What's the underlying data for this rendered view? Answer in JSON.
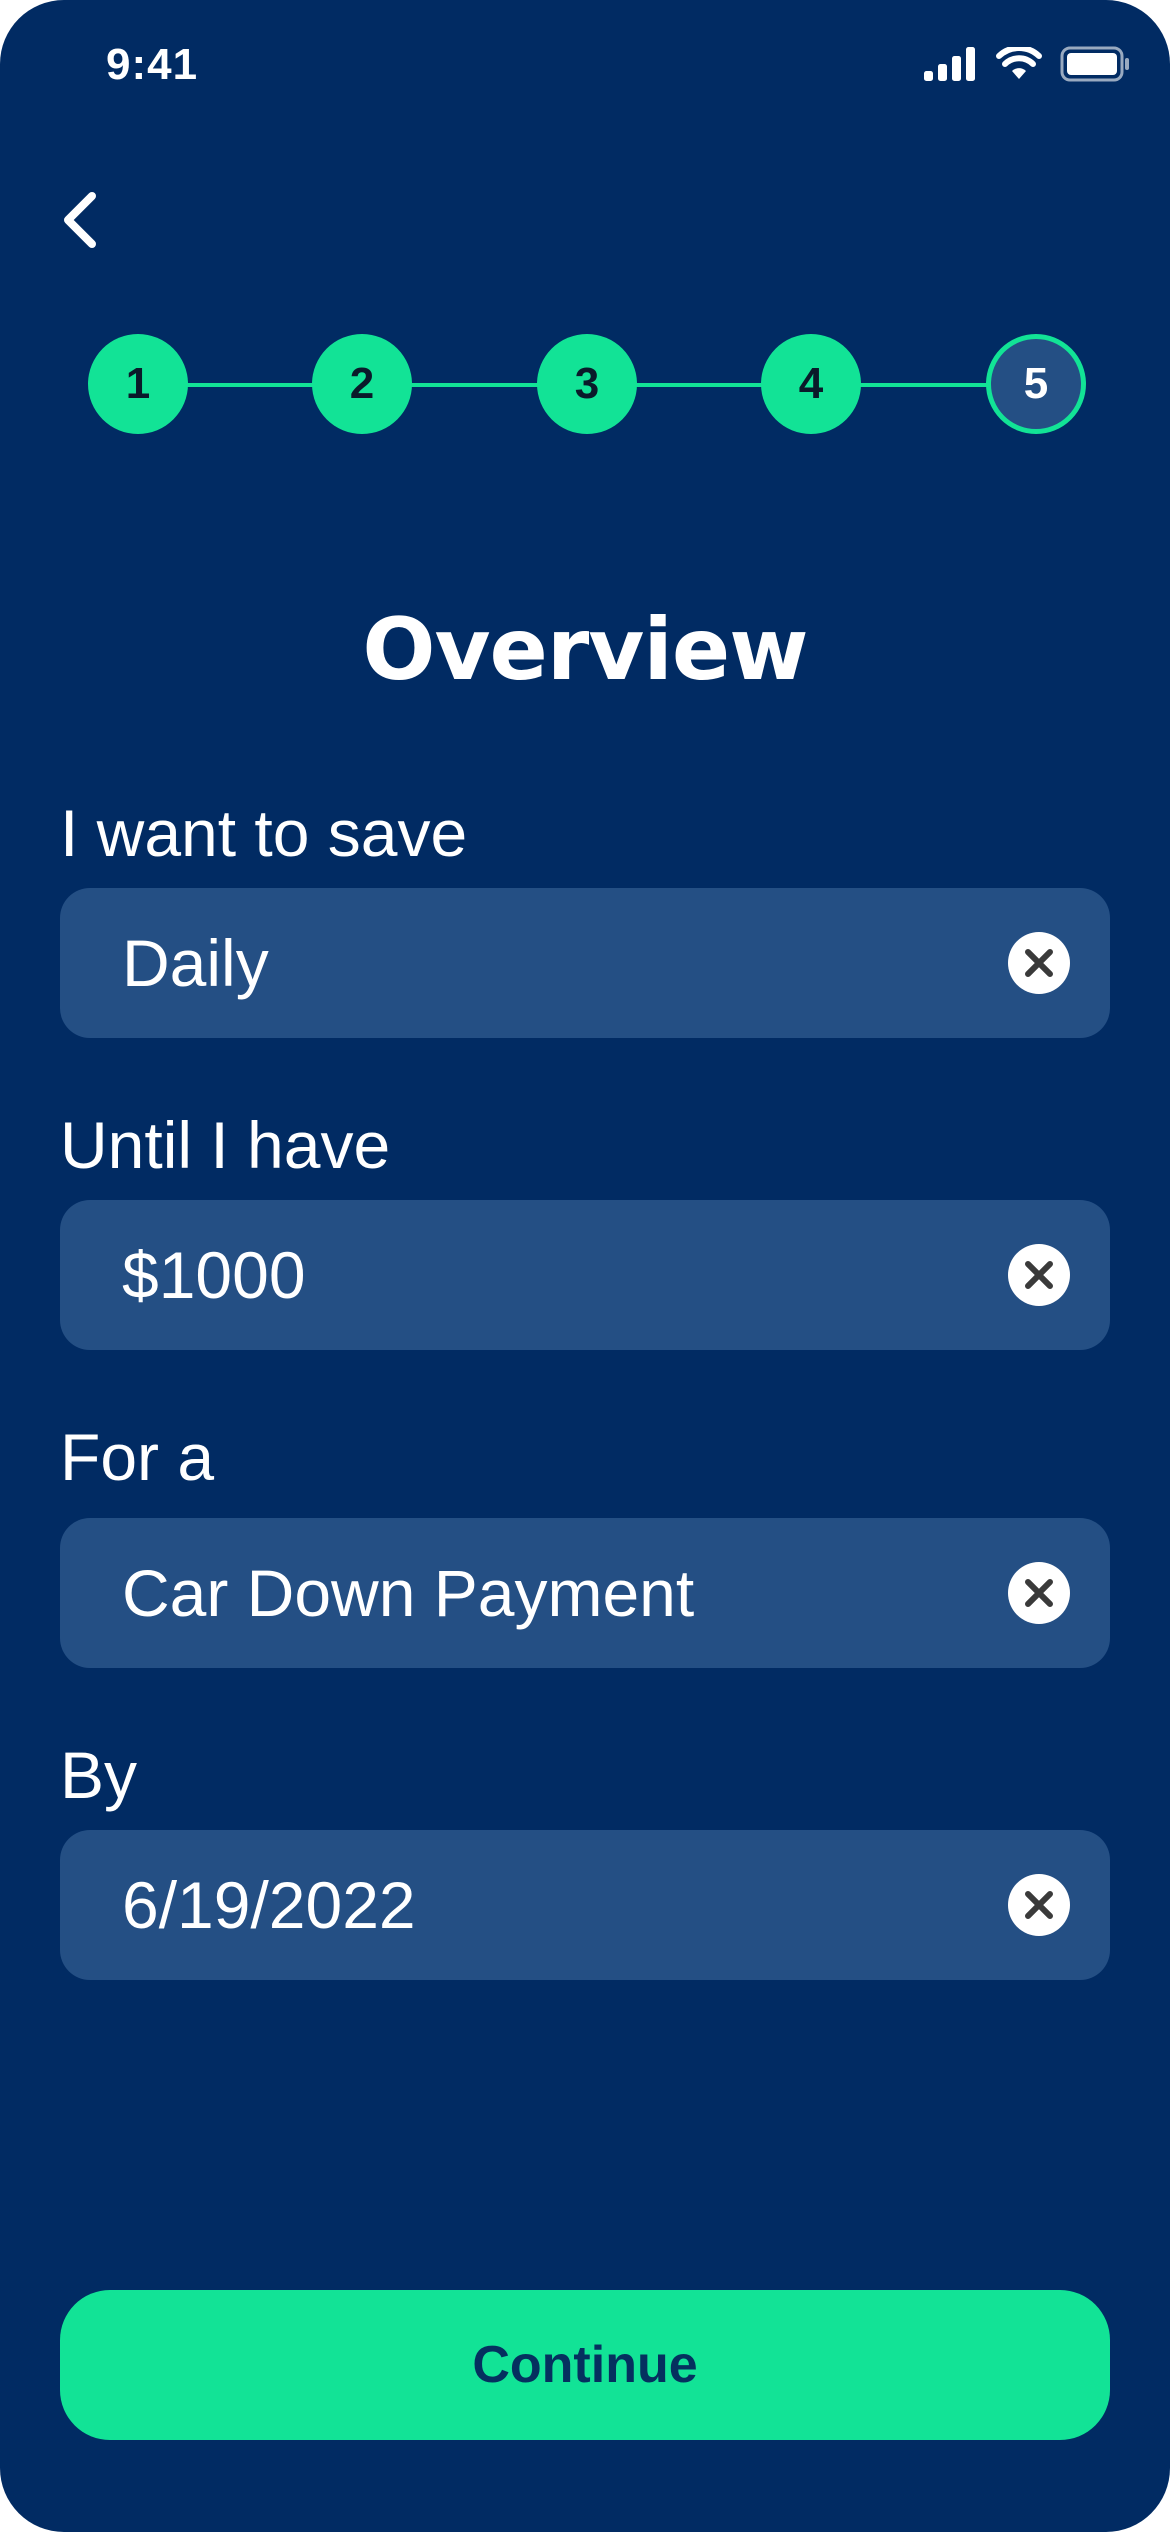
{
  "status_bar": {
    "time": "9:41"
  },
  "colors": {
    "background": "#012b63",
    "field": "#244f84",
    "accent": "#12e396",
    "button_text": "#05305f"
  },
  "stepper": {
    "steps": [
      {
        "label": "1",
        "state": "completed"
      },
      {
        "label": "2",
        "state": "completed"
      },
      {
        "label": "3",
        "state": "completed"
      },
      {
        "label": "4",
        "state": "completed"
      },
      {
        "label": "5",
        "state": "current"
      }
    ]
  },
  "page": {
    "title": "Overview"
  },
  "fields": [
    {
      "label": "I want to save",
      "value": "Daily",
      "icon": "clear-icon"
    },
    {
      "label": "Until I have",
      "value": "$1000",
      "icon": "clear-icon"
    },
    {
      "label": "For a",
      "value": "Car Down Payment",
      "icon": "clear-icon"
    },
    {
      "label": "By",
      "value": "6/19/2022",
      "icon": "clear-icon"
    }
  ],
  "actions": {
    "continue_label": "Continue"
  },
  "icons": {
    "back": "chevron-left-icon",
    "signal": "cellular-signal-icon",
    "wifi": "wifi-icon",
    "battery": "battery-icon"
  }
}
